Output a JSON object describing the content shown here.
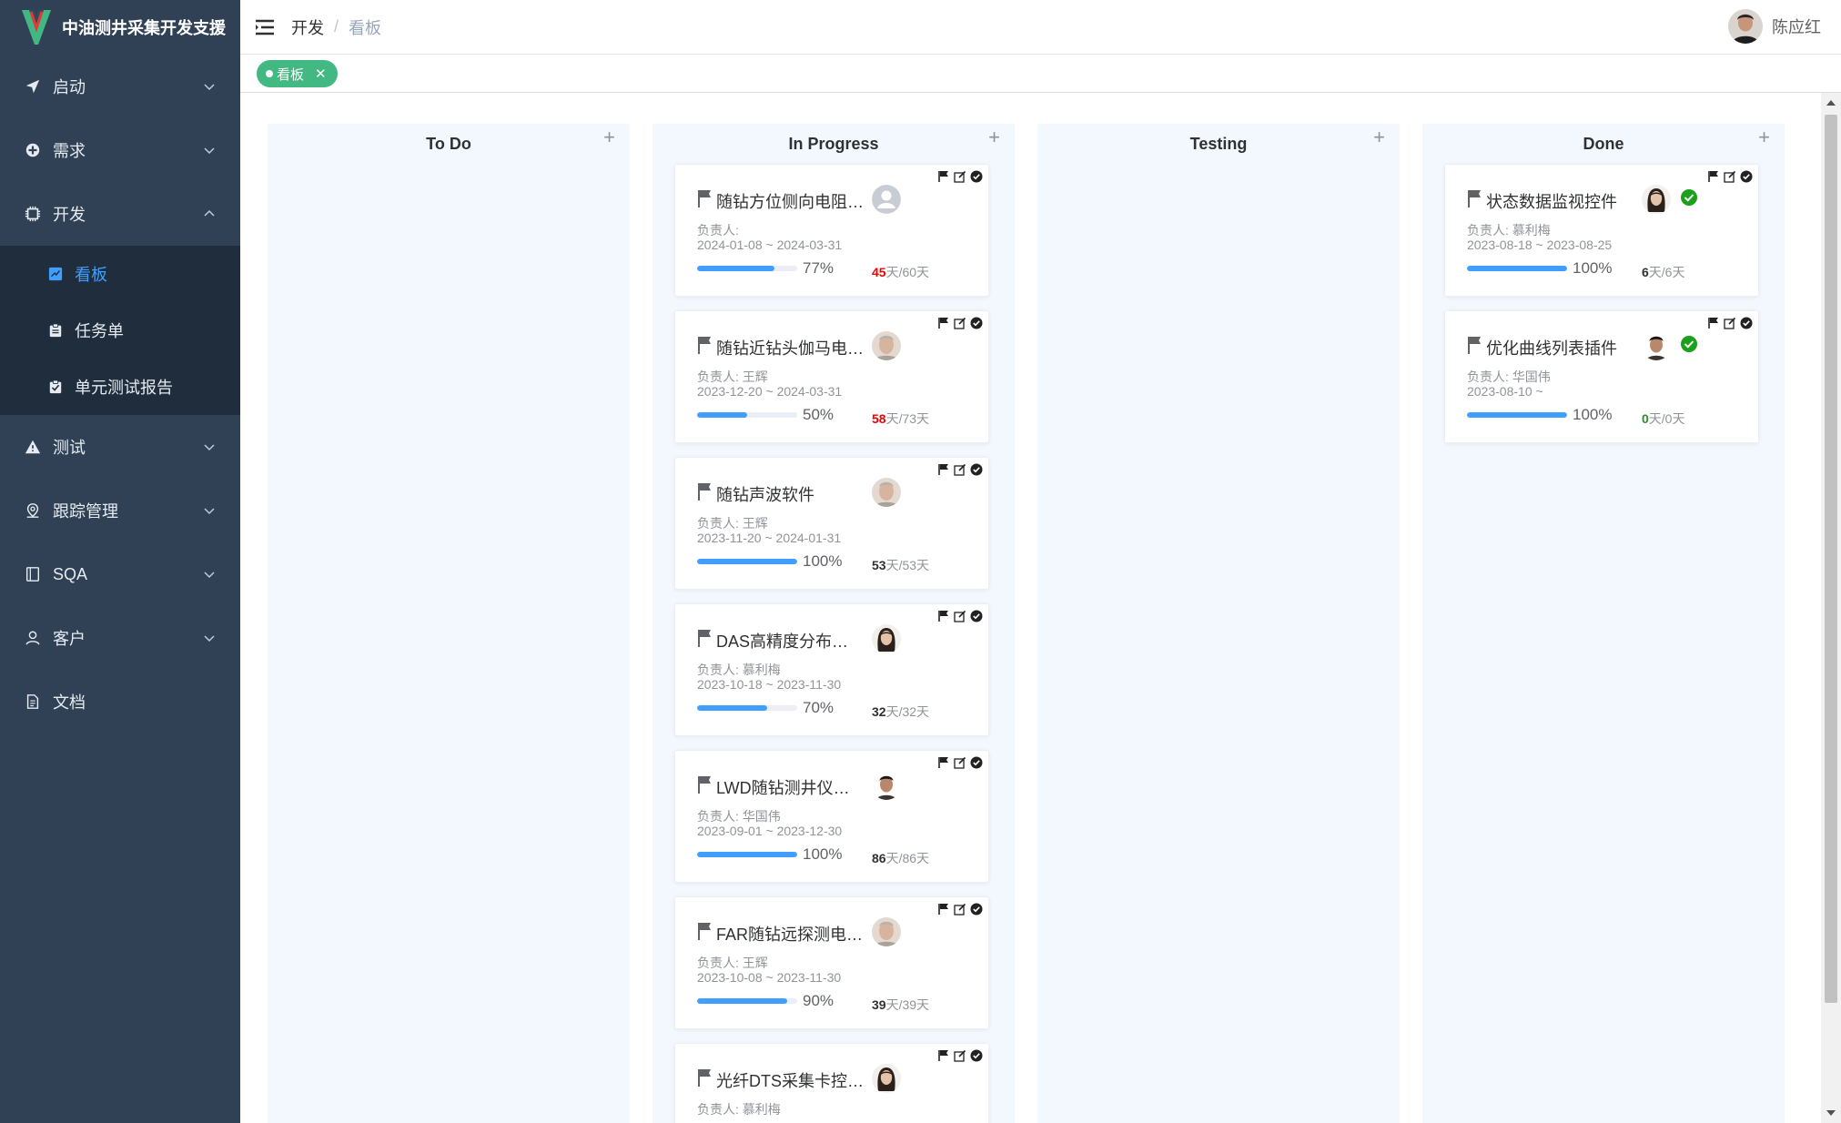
{
  "app": {
    "title": "中油测井采集开发支援",
    "accent": "#409eff",
    "sidebar_bg": "#304156"
  },
  "sidebar": {
    "items": [
      {
        "label": "启动",
        "icon": "send-icon"
      },
      {
        "label": "需求",
        "icon": "plus-circle-icon"
      },
      {
        "label": "开发",
        "icon": "cpu-icon",
        "expanded": true,
        "children": [
          {
            "label": "看板",
            "icon": "board-icon",
            "active": true
          },
          {
            "label": "任务单",
            "icon": "clipboard-icon"
          },
          {
            "label": "单元测试报告",
            "icon": "clipboard-check-icon"
          }
        ]
      },
      {
        "label": "测试",
        "icon": "warning-icon"
      },
      {
        "label": "跟踪管理",
        "icon": "location-icon"
      },
      {
        "label": "SQA",
        "icon": "notebook-icon"
      },
      {
        "label": "客户",
        "icon": "user-icon"
      },
      {
        "label": "文档",
        "icon": "document-icon"
      }
    ]
  },
  "header": {
    "breadcrumb": [
      "开发",
      "看板"
    ],
    "user_name": "陈应红"
  },
  "tags": [
    {
      "label": "看板",
      "color": "#42b983"
    }
  ],
  "board": {
    "columns": [
      {
        "title": "To Do",
        "cards": []
      },
      {
        "title": "In Progress",
        "cards": [
          {
            "title": "随钻方位侧向电阻…",
            "owner": "负责人:",
            "dates": "2024-01-08 ~ 2024-03-31",
            "progress": 77,
            "progress_label": "77%",
            "days_used": "45",
            "days_total": "天/60天",
            "days_status": "late",
            "avatar": "default-avatar-icon"
          },
          {
            "title": "随钻近钻头伽马电…",
            "owner": "负责人: 王辉",
            "dates": "2023-12-20 ~ 2024-03-31",
            "progress": 50,
            "progress_label": "50%",
            "days_used": "58",
            "days_total": "天/73天",
            "days_status": "late",
            "avatar": "older-man-avatar"
          },
          {
            "title": "随钻声波软件",
            "owner": "负责人: 王辉",
            "dates": "2023-11-20 ~ 2024-01-31",
            "progress": 100,
            "progress_label": "100%",
            "days_used": "53",
            "days_total": "天/53天",
            "days_status": "normal",
            "avatar": "older-man-avatar"
          },
          {
            "title": "DAS高精度分布…",
            "owner": "负责人: 慕利梅",
            "dates": "2023-10-18 ~ 2023-11-30",
            "progress": 70,
            "progress_label": "70%",
            "days_used": "32",
            "days_total": "天/32天",
            "days_status": "normal",
            "avatar": "woman-avatar"
          },
          {
            "title": "LWD随钻测井仪…",
            "owner": "负责人: 华国伟",
            "dates": "2023-09-01 ~ 2023-12-30",
            "progress": 100,
            "progress_label": "100%",
            "days_used": "86",
            "days_total": "天/86天",
            "days_status": "normal",
            "avatar": "man-avatar"
          },
          {
            "title": "FAR随钻远探测电…",
            "owner": "负责人: 王辉",
            "dates": "2023-10-08 ~ 2023-11-30",
            "progress": 90,
            "progress_label": "90%",
            "days_used": "39",
            "days_total": "天/39天",
            "days_status": "normal",
            "avatar": "older-man-avatar"
          },
          {
            "title": "光纤DTS采集卡控…",
            "owner": "负责人: 慕利梅",
            "dates": "",
            "progress": 0,
            "progress_label": "",
            "days_used": "",
            "days_total": "",
            "days_status": "normal",
            "avatar": "woman-avatar"
          }
        ]
      },
      {
        "title": "Testing",
        "cards": []
      },
      {
        "title": "Done",
        "cards": [
          {
            "title": "状态数据监视控件",
            "owner": "负责人: 慕利梅",
            "dates": "2023-08-18 ~ 2023-08-25",
            "progress": 100,
            "progress_label": "100%",
            "days_used": "6",
            "days_total": "天/6天",
            "days_status": "normal",
            "avatar": "woman-avatar",
            "done": true
          },
          {
            "title": "优化曲线列表插件",
            "owner": "负责人: 华国伟",
            "dates": "2023-08-10 ~",
            "progress": 100,
            "progress_label": "100%",
            "days_used": "0",
            "days_total": "天/0天",
            "days_status": "ok",
            "avatar": "man-avatar",
            "done": true
          }
        ]
      }
    ]
  }
}
